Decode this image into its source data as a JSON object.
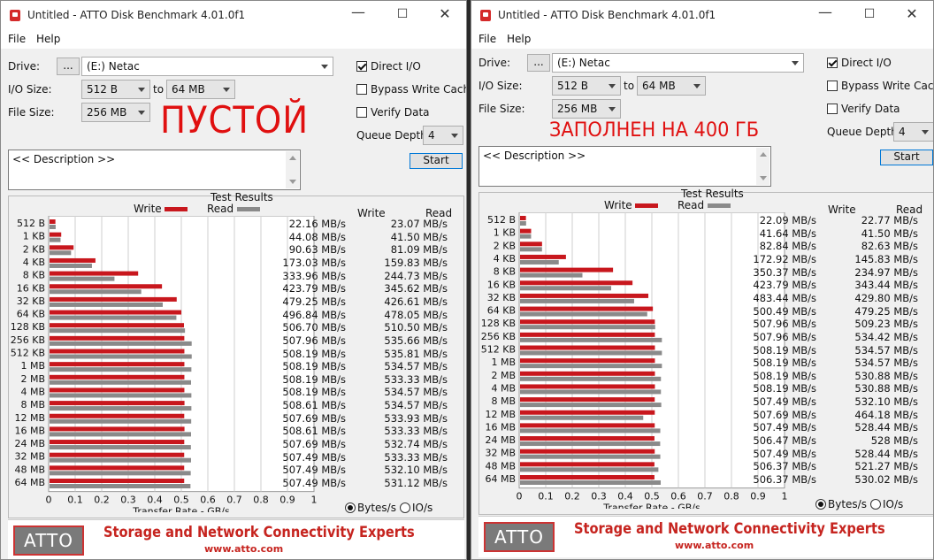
{
  "windows": [
    {
      "title": "Untitled - ATTO Disk Benchmark 4.01.0f1",
      "menu": [
        "File",
        "Help"
      ],
      "drive_label": "Drive:",
      "browse_label": "...",
      "drive_value": "(E:) Netac",
      "io_size_label": "I/O Size:",
      "io_from": "512 B",
      "to_label": "to",
      "io_to": "64 MB",
      "file_size_label": "File Size:",
      "file_size": "256 MB",
      "annotation": "ПУСТОЙ",
      "direct_io_label": "Direct I/O",
      "direct_io_checked": true,
      "bypass_label": "Bypass Write Cache",
      "bypass_checked": false,
      "verify_label": "Verify Data",
      "verify_checked": false,
      "queue_depth_label": "Queue Depth:",
      "queue_depth": "4",
      "description": "<< Description >>",
      "start_label": "Start",
      "results_title": "Test Results",
      "legend_write": "Write",
      "legend_read": "Read",
      "col_write": "Write",
      "col_read": "Read",
      "axis_ticks": [
        "0",
        "0.1",
        "0.2",
        "0.3",
        "0.4",
        "0.5",
        "0.6",
        "0.7",
        "0.8",
        "0.9",
        "1"
      ],
      "xlabel": "Transfer Rate - GB/s",
      "unit_bytes": "Bytes/s",
      "unit_io": "IO/s",
      "unit_selected": "bytes",
      "logo": "ATTO",
      "tagline": "Storage and Network Connectivity Experts",
      "url": "www.atto.com",
      "rows": [
        {
          "size": "512 B",
          "write": "22.16 MB/s",
          "read": "23.07 MB/s"
        },
        {
          "size": "1 KB",
          "write": "44.08 MB/s",
          "read": "41.50 MB/s"
        },
        {
          "size": "2 KB",
          "write": "90.63 MB/s",
          "read": "81.09 MB/s"
        },
        {
          "size": "4 KB",
          "write": "173.03 MB/s",
          "read": "159.83 MB/s"
        },
        {
          "size": "8 KB",
          "write": "333.96 MB/s",
          "read": "244.73 MB/s"
        },
        {
          "size": "16 KB",
          "write": "423.79 MB/s",
          "read": "345.62 MB/s"
        },
        {
          "size": "32 KB",
          "write": "479.25 MB/s",
          "read": "426.61 MB/s"
        },
        {
          "size": "64 KB",
          "write": "496.84 MB/s",
          "read": "478.05 MB/s"
        },
        {
          "size": "128 KB",
          "write": "506.70 MB/s",
          "read": "510.50 MB/s"
        },
        {
          "size": "256 KB",
          "write": "507.96 MB/s",
          "read": "535.66 MB/s"
        },
        {
          "size": "512 KB",
          "write": "508.19 MB/s",
          "read": "535.81 MB/s"
        },
        {
          "size": "1 MB",
          "write": "508.19 MB/s",
          "read": "534.57 MB/s"
        },
        {
          "size": "2 MB",
          "write": "508.19 MB/s",
          "read": "533.33 MB/s"
        },
        {
          "size": "4 MB",
          "write": "508.19 MB/s",
          "read": "534.57 MB/s"
        },
        {
          "size": "8 MB",
          "write": "508.61 MB/s",
          "read": "534.57 MB/s"
        },
        {
          "size": "12 MB",
          "write": "507.69 MB/s",
          "read": "533.93 MB/s"
        },
        {
          "size": "16 MB",
          "write": "508.61 MB/s",
          "read": "533.33 MB/s"
        },
        {
          "size": "24 MB",
          "write": "507.69 MB/s",
          "read": "532.74 MB/s"
        },
        {
          "size": "32 MB",
          "write": "507.49 MB/s",
          "read": "533.33 MB/s"
        },
        {
          "size": "48 MB",
          "write": "507.49 MB/s",
          "read": "532.10 MB/s"
        },
        {
          "size": "64 MB",
          "write": "507.49 MB/s",
          "read": "531.12 MB/s"
        }
      ]
    },
    {
      "title": "Untitled - ATTO Disk Benchmark 4.01.0f1",
      "menu": [
        "File",
        "Help"
      ],
      "drive_label": "Drive:",
      "browse_label": "...",
      "drive_value": "(E:) Netac",
      "io_size_label": "I/O Size:",
      "io_from": "512 B",
      "to_label": "to",
      "io_to": "64 MB",
      "file_size_label": "File Size:",
      "file_size": "256 MB",
      "annotation": "ЗАПОЛНЕН НА 400 ГБ",
      "direct_io_label": "Direct I/O",
      "direct_io_checked": true,
      "bypass_label": "Bypass Write Cache",
      "bypass_checked": false,
      "verify_label": "Verify Data",
      "verify_checked": false,
      "queue_depth_label": "Queue Depth:",
      "queue_depth": "4",
      "description": "<< Description >>",
      "start_label": "Start",
      "results_title": "Test Results",
      "legend_write": "Write",
      "legend_read": "Read",
      "col_write": "Write",
      "col_read": "Read",
      "axis_ticks": [
        "0",
        "0.1",
        "0.2",
        "0.3",
        "0.4",
        "0.5",
        "0.6",
        "0.7",
        "0.8",
        "0.9",
        "1"
      ],
      "xlabel": "Transfer Rate - GB/s",
      "unit_bytes": "Bytes/s",
      "unit_io": "IO/s",
      "unit_selected": "bytes",
      "logo": "ATTO",
      "tagline": "Storage and Network Connectivity Experts",
      "url": "www.atto.com",
      "rows": [
        {
          "size": "512 B",
          "write": "22.09 MB/s",
          "read": "22.77 MB/s"
        },
        {
          "size": "1 KB",
          "write": "41.64 MB/s",
          "read": "41.50 MB/s"
        },
        {
          "size": "2 KB",
          "write": "82.84 MB/s",
          "read": "82.63 MB/s"
        },
        {
          "size": "4 KB",
          "write": "172.92 MB/s",
          "read": "145.83 MB/s"
        },
        {
          "size": "8 KB",
          "write": "350.37 MB/s",
          "read": "234.97 MB/s"
        },
        {
          "size": "16 KB",
          "write": "423.79 MB/s",
          "read": "343.44 MB/s"
        },
        {
          "size": "32 KB",
          "write": "483.44 MB/s",
          "read": "429.80 MB/s"
        },
        {
          "size": "64 KB",
          "write": "500.49 MB/s",
          "read": "479.25 MB/s"
        },
        {
          "size": "128 KB",
          "write": "507.96 MB/s",
          "read": "509.23 MB/s"
        },
        {
          "size": "256 KB",
          "write": "507.96 MB/s",
          "read": "534.42 MB/s"
        },
        {
          "size": "512 KB",
          "write": "508.19 MB/s",
          "read": "534.57 MB/s"
        },
        {
          "size": "1 MB",
          "write": "508.19 MB/s",
          "read": "534.57 MB/s"
        },
        {
          "size": "2 MB",
          "write": "508.19 MB/s",
          "read": "530.88 MB/s"
        },
        {
          "size": "4 MB",
          "write": "508.19 MB/s",
          "read": "530.88 MB/s"
        },
        {
          "size": "8 MB",
          "write": "507.49 MB/s",
          "read": "532.10 MB/s"
        },
        {
          "size": "12 MB",
          "write": "507.69 MB/s",
          "read": "464.18 MB/s"
        },
        {
          "size": "16 MB",
          "write": "507.49 MB/s",
          "read": "528.44 MB/s"
        },
        {
          "size": "24 MB",
          "write": "506.47 MB/s",
          "read": "528 MB/s"
        },
        {
          "size": "32 MB",
          "write": "507.49 MB/s",
          "read": "528.44 MB/s"
        },
        {
          "size": "48 MB",
          "write": "506.37 MB/s",
          "read": "521.27 MB/s"
        },
        {
          "size": "64 MB",
          "write": "506.37 MB/s",
          "read": "530.02 MB/s"
        }
      ]
    }
  ],
  "colors": {
    "write": "#c8171d",
    "read": "#8a8a8a",
    "annotation": "#e01010",
    "brand": "#c6241f"
  },
  "chart_data": [
    {
      "type": "bar",
      "categories": [
        "512 B",
        "1 KB",
        "2 KB",
        "4 KB",
        "8 KB",
        "16 KB",
        "32 KB",
        "64 KB",
        "128 KB",
        "256 KB",
        "512 KB",
        "1 MB",
        "2 MB",
        "4 MB",
        "8 MB",
        "12 MB",
        "16 MB",
        "24 MB",
        "32 MB",
        "48 MB",
        "64 MB"
      ],
      "series": [
        {
          "name": "Write",
          "values": [
            22.16,
            44.08,
            90.63,
            173.03,
            333.96,
            423.79,
            479.25,
            496.84,
            506.7,
            507.96,
            508.19,
            508.19,
            508.19,
            508.19,
            508.61,
            507.69,
            508.61,
            507.69,
            507.49,
            507.49,
            507.49
          ]
        },
        {
          "name": "Read",
          "values": [
            23.07,
            41.5,
            81.09,
            159.83,
            244.73,
            345.62,
            426.61,
            478.05,
            510.5,
            535.66,
            535.81,
            534.57,
            533.33,
            534.57,
            534.57,
            533.93,
            533.33,
            532.74,
            533.33,
            532.1,
            531.12
          ]
        }
      ],
      "title": "Test Results",
      "xlabel": "Transfer Rate - GB/s",
      "xlim": [
        0,
        1
      ],
      "grid": true,
      "legend": "top"
    },
    {
      "type": "bar",
      "categories": [
        "512 B",
        "1 KB",
        "2 KB",
        "4 KB",
        "8 KB",
        "16 KB",
        "32 KB",
        "64 KB",
        "128 KB",
        "256 KB",
        "512 KB",
        "1 MB",
        "2 MB",
        "4 MB",
        "8 MB",
        "12 MB",
        "16 MB",
        "24 MB",
        "32 MB",
        "48 MB",
        "64 MB"
      ],
      "series": [
        {
          "name": "Write",
          "values": [
            22.09,
            41.64,
            82.84,
            172.92,
            350.37,
            423.79,
            483.44,
            500.49,
            507.96,
            507.96,
            508.19,
            508.19,
            508.19,
            508.19,
            507.49,
            507.69,
            507.49,
            506.47,
            507.49,
            506.37,
            506.37
          ]
        },
        {
          "name": "Read",
          "values": [
            22.77,
            41.5,
            82.63,
            145.83,
            234.97,
            343.44,
            429.8,
            479.25,
            509.23,
            534.42,
            534.57,
            534.57,
            530.88,
            530.88,
            532.1,
            464.18,
            528.44,
            528,
            528.44,
            521.27,
            530.02
          ]
        }
      ],
      "title": "Test Results",
      "xlabel": "Transfer Rate - GB/s",
      "xlim": [
        0,
        1
      ],
      "grid": true,
      "legend": "top"
    }
  ]
}
